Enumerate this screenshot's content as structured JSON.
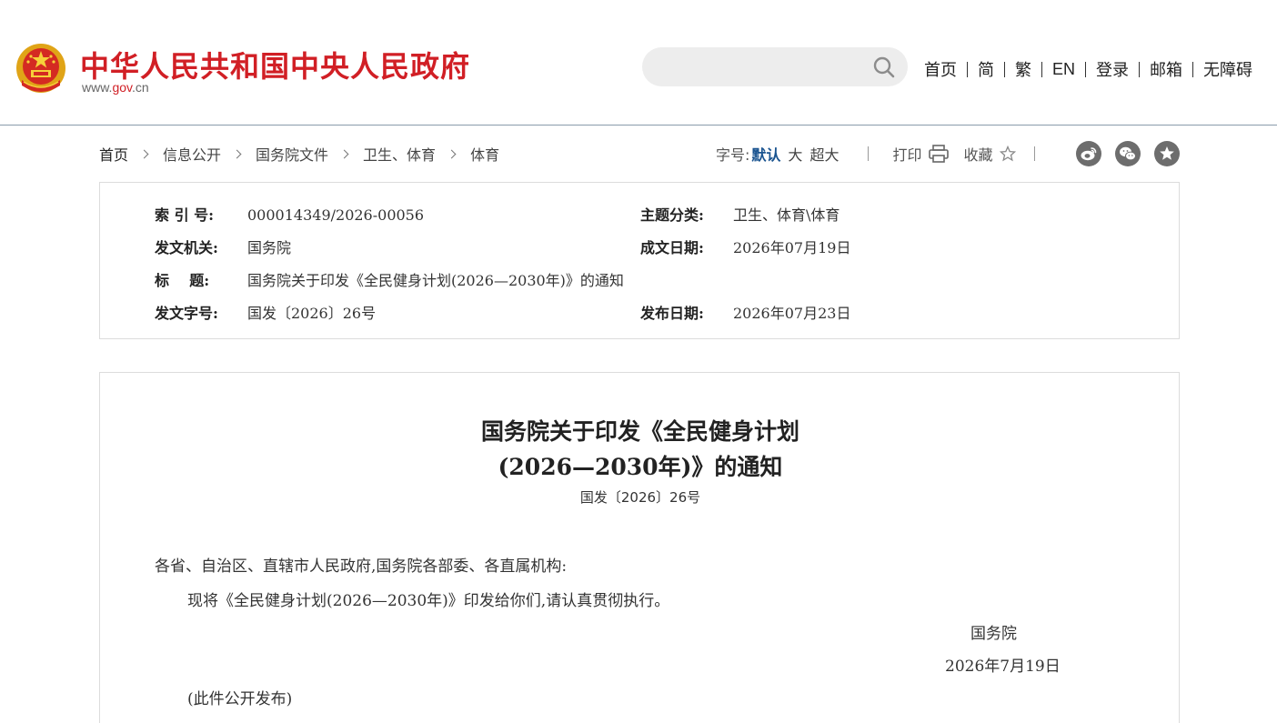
{
  "header": {
    "site_name": "中华人民共和国中央人民政府",
    "site_domain_prefix": "www.",
    "site_domain_main": "gov",
    "site_domain_suffix": ".cn",
    "search_placeholder": "",
    "search_icon": "search-icon",
    "nav": [
      "首页",
      "简",
      "繁",
      "EN",
      "登录",
      "邮箱",
      "无障碍"
    ]
  },
  "breadcrumb": [
    "首页",
    "信息公开",
    "国务院文件",
    "卫生、体育",
    "体育"
  ],
  "tools": {
    "font_size_label": "字号:",
    "font_size_default": "默认",
    "font_size_large": "大",
    "font_size_xlarge": "超大",
    "print_label": "打印",
    "favorite_label": "收藏"
  },
  "share_icons": [
    "weibo-icon",
    "wechat-icon",
    "star-icon"
  ],
  "meta": {
    "index_no_label": "索 引 号:",
    "index_no": "000014349/2026-00056",
    "category_label": "主题分类:",
    "category": "卫生、体育\\体育",
    "issuer_label": "发文机关:",
    "issuer": "国务院",
    "written_date_label": "成文日期:",
    "written_date": "2026年07月19日",
    "title_label": "标    题:",
    "title": "国务院关于印发《全民健身计划(2026—2030年)》的通知",
    "doc_no_label": "发文字号:",
    "doc_no": "国发〔2026〕26号",
    "publish_date_label": "发布日期:",
    "publish_date": "2026年07月23日"
  },
  "article": {
    "title_line1": "国务院关于印发《全民健身计划",
    "title_line2": "(2026—2030年)》的通知",
    "doc_no": "国发〔2026〕26号",
    "salutation": "各省、自治区、直辖市人民政府,国务院各部委、各直属机构:",
    "body": "现将《全民健身计划(2026—2030年)》印发给你们,请认真贯彻执行。",
    "signature": "国务院",
    "sign_date": "2026年7月19日",
    "note": "(此件公开发布)"
  },
  "colors": {
    "brand_red": "#d11f25",
    "accent_blue": "#1a5490",
    "icon_grey": "#6d6d6d"
  }
}
